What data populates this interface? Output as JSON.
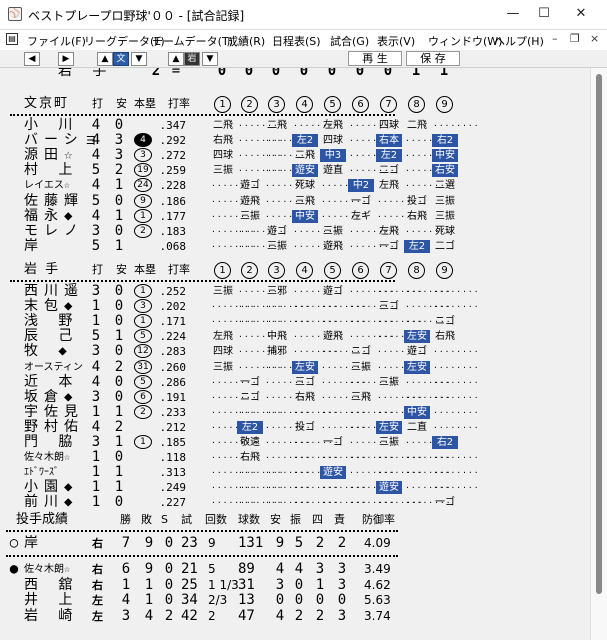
{
  "window": {
    "title": "ベストプレープロ野球'００ - [試合記録]",
    "icon": "baseball-cap-icon"
  },
  "menu": [
    "ファイル(F)",
    "リーグデータ(L)",
    "チームデータ(T)",
    "成績(R)",
    "日程表(S)",
    "試合(G)",
    "表示(V)",
    "ウィンドウ(W)",
    "ヘルプ(H)"
  ],
  "toolbar": {
    "left": "◀",
    "right": "▶",
    "team1": "文",
    "team2": "岩",
    "replay": "再 生",
    "save": "保 存"
  },
  "scoreline": {
    "team": "岩 手",
    "total": "2",
    "eq": "=",
    "innings": [
      "0",
      "0",
      "0",
      "0",
      "0",
      "0",
      "0",
      "1",
      "1"
    ]
  },
  "teams": [
    {
      "name": "文京町",
      "headers": {
        "ab": "打",
        "h": "安",
        "hr": "本塁",
        "avg": "打率"
      },
      "innings": [
        "1",
        "2",
        "3",
        "4",
        "5",
        "6",
        "7",
        "8",
        "9"
      ],
      "players": [
        {
          "name": "小 川",
          "ab": "4",
          "h": "0",
          "hr": "",
          "avg": ".347",
          "results": [
            "二飛",
            "",
            "二飛",
            "",
            "左飛",
            "",
            "四球",
            "二飛",
            ""
          ]
        },
        {
          "name": "バーショ",
          "ab": "4",
          "h": "3",
          "hr": "4",
          "hrfill": true,
          "avg": ".292",
          "results": [
            "右飛",
            "",
            "",
            "左2",
            "四球",
            "",
            "右本",
            "",
            "右2"
          ],
          "hl": [
            3,
            6,
            8
          ]
        },
        {
          "name": "源田☆",
          "ab": "4",
          "h": "3",
          "hr": "3",
          "avg": ".272",
          "results": [
            "四球",
            "",
            "",
            "二飛",
            "中3",
            "",
            "左2",
            "",
            "中安"
          ],
          "hl": [
            4,
            6,
            8
          ]
        },
        {
          "name": "村 上",
          "ab": "5",
          "h": "2",
          "hr": "19",
          "avg": ".259",
          "results": [
            "三振",
            "",
            "",
            "遊安",
            "遊直",
            "",
            "二ゴ",
            "",
            "右安"
          ],
          "hl": [
            3,
            8
          ]
        },
        {
          "name": "レイエス☆",
          "small": true,
          "ab": "4",
          "h": "1",
          "hr": "24",
          "avg": ".228",
          "results": [
            "",
            "遊ゴ",
            "",
            "死球",
            "",
            "中2",
            "左飛",
            "",
            "二選"
          ],
          "hl": [
            5
          ]
        },
        {
          "name": "佐藤輝",
          "ab": "5",
          "h": "0",
          "hr": "9",
          "avg": ".186",
          "results": [
            "",
            "遊飛",
            "",
            "三飛",
            "",
            "一ゴ",
            "",
            "投ゴ",
            "三振"
          ]
        },
        {
          "name": "福永◆",
          "ab": "4",
          "h": "1",
          "hr": "1",
          "avg": ".177",
          "results": [
            "",
            "三振",
            "",
            "中安",
            "",
            "左ギ",
            "",
            "右飛",
            "三振"
          ],
          "hl": [
            3
          ]
        },
        {
          "name": "モレノ",
          "ab": "3",
          "h": "0",
          "hr": "2",
          "avg": ".183",
          "results": [
            "",
            "",
            "遊ゴ",
            "",
            "三振",
            "",
            "左飛",
            "",
            "死球"
          ]
        },
        {
          "name": "岸",
          "ab": "5",
          "h": "1",
          "hr": "",
          "avg": ".068",
          "results": [
            "",
            "",
            "三振",
            "",
            "遊飛",
            "",
            "一ゴ",
            "左2",
            "二ゴ"
          ],
          "hl": [
            7
          ]
        }
      ]
    },
    {
      "name": "岩 手",
      "headers": {
        "ab": "打",
        "h": "安",
        "hr": "本塁",
        "avg": "打率"
      },
      "innings": [
        "1",
        "2",
        "3",
        "4",
        "5",
        "6",
        "7",
        "8",
        "9"
      ],
      "players": [
        {
          "name": "西川遥",
          "ab": "3",
          "h": "0",
          "hr": "1",
          "avg": ".252",
          "results": [
            "三振",
            "",
            "三邪",
            "",
            "遊ゴ",
            "",
            "",
            "",
            ""
          ]
        },
        {
          "name": "末包◆",
          "ab": "1",
          "h": "0",
          "hr": "3",
          "avg": ".202",
          "results": [
            "",
            "",
            "",
            "",
            "",
            "",
            "三ゴ",
            "",
            ""
          ]
        },
        {
          "name": "浅 野",
          "ab": "1",
          "h": "0",
          "hr": "1",
          "avg": ".171",
          "results": [
            "",
            "",
            "",
            "",
            "",
            "",
            "",
            "",
            "ニゴ"
          ]
        },
        {
          "name": "辰 己",
          "ab": "5",
          "h": "1",
          "hr": "5",
          "avg": ".224",
          "results": [
            "左飛",
            "",
            "中飛",
            "",
            "遊飛",
            "",
            "",
            "左安",
            "右飛"
          ],
          "hl": [
            7
          ]
        },
        {
          "name": "牧 ◆",
          "ab": "3",
          "h": "0",
          "hr": "12",
          "avg": ".283",
          "results": [
            "四球",
            "",
            "捕邪",
            "",
            "",
            "ニゴ",
            "",
            "遊ゴ",
            ""
          ]
        },
        {
          "name": "オースティン",
          "small": true,
          "ab": "4",
          "h": "2",
          "hr": "31",
          "avg": ".260",
          "results": [
            "三振",
            "",
            "",
            "左安",
            "",
            "三振",
            "",
            "左安",
            ""
          ],
          "hl": [
            3,
            7
          ]
        },
        {
          "name": "近 本",
          "ab": "4",
          "h": "0",
          "hr": "5",
          "avg": ".286",
          "results": [
            "",
            "一ゴ",
            "",
            "三ゴ",
            "",
            "",
            "三振",
            "",
            ""
          ]
        },
        {
          "name": "坂倉◆",
          "ab": "3",
          "h": "0",
          "hr": "6",
          "avg": ".191",
          "results": [
            "",
            "ニゴ",
            "",
            "右飛",
            "",
            "三飛",
            "",
            "",
            ""
          ]
        },
        {
          "name": "宇佐見",
          "ab": "1",
          "h": "1",
          "hr": "2",
          "avg": ".233",
          "results": [
            "",
            "",
            "",
            "",
            "",
            "",
            "",
            "中安",
            ""
          ],
          "hl": [
            7
          ]
        },
        {
          "name": "野村佑",
          "ab": "4",
          "h": "2",
          "hr": "",
          "avg": ".212",
          "results": [
            "",
            "左2",
            "",
            "投ゴ",
            "",
            "",
            "左安",
            "二直",
            ""
          ],
          "hl": [
            1,
            6
          ]
        },
        {
          "name": "門 脇",
          "ab": "3",
          "h": "1",
          "hr": "1",
          "avg": ".185",
          "results": [
            "",
            "敬遠",
            "",
            "",
            "一ゴ",
            "",
            "三振",
            "",
            "右2"
          ],
          "hl": [
            8
          ]
        },
        {
          "name": "佐々木朗☆",
          "small": true,
          "ab": "1",
          "h": "0",
          "hr": "",
          "avg": ".118",
          "results": [
            "",
            "右飛",
            "",
            "",
            "",
            "",
            "",
            "",
            ""
          ]
        },
        {
          "name": "ｴﾄﾞﾜｰｽﾞ",
          "small": true,
          "ab": "1",
          "h": "1",
          "hr": "",
          "avg": ".313",
          "results": [
            "",
            "",
            "",
            "",
            "遊安",
            "",
            "",
            "",
            ""
          ],
          "hl": [
            4
          ]
        },
        {
          "name": "小園◆",
          "ab": "1",
          "h": "1",
          "hr": "",
          "avg": ".249",
          "results": [
            "",
            "",
            "",
            "",
            "",
            "",
            "遊安",
            "",
            ""
          ],
          "hl": [
            6
          ]
        },
        {
          "name": "前川◆",
          "ab": "1",
          "h": "0",
          "hr": "",
          "avg": ".227",
          "results": [
            "",
            "",
            "",
            "",
            "",
            "",
            "",
            "",
            "一ゴ"
          ]
        }
      ]
    }
  ],
  "pitching": {
    "title": "投手成績",
    "headers": [
      "勝",
      "敗",
      "S",
      "試",
      "回数",
      "球数",
      "安",
      "振",
      "四",
      "責",
      "防御率"
    ],
    "rows": [
      {
        "mark": "○",
        "name": "岸",
        "hand": "右",
        "w": "7",
        "l": "9",
        "s": "0",
        "g": "23",
        "ip": "9",
        "pc": "131",
        "h": "9",
        "k": "5",
        "bb": "2",
        "er": "2",
        "era": "4.09"
      },
      {
        "mark": "●",
        "name": "佐々木朗☆",
        "small": true,
        "hand": "右",
        "w": "6",
        "l": "9",
        "s": "0",
        "g": "21",
        "ip": "5",
        "pc": "89",
        "h": "4",
        "k": "4",
        "bb": "3",
        "er": "3",
        "era": "3.49"
      },
      {
        "mark": "",
        "name": "西 舘",
        "hand": "右",
        "w": "1",
        "l": "1",
        "s": "0",
        "g": "25",
        "ip": "1 1/3",
        "pc": "31",
        "h": "3",
        "k": "0",
        "bb": "1",
        "er": "3",
        "era": "4.62"
      },
      {
        "mark": "",
        "name": "井 上",
        "hand": "左",
        "w": "4",
        "l": "1",
        "s": "0",
        "g": "34",
        "ip": "2/3",
        "pc": "13",
        "h": "0",
        "k": "0",
        "bb": "0",
        "er": "0",
        "era": "5.63"
      },
      {
        "mark": "",
        "name": "岩 崎",
        "hand": "左",
        "w": "3",
        "l": "4",
        "s": "2",
        "g": "42",
        "ip": "2",
        "pc": "47",
        "h": "4",
        "k": "2",
        "bb": "2",
        "er": "3",
        "era": "3.74"
      }
    ]
  }
}
